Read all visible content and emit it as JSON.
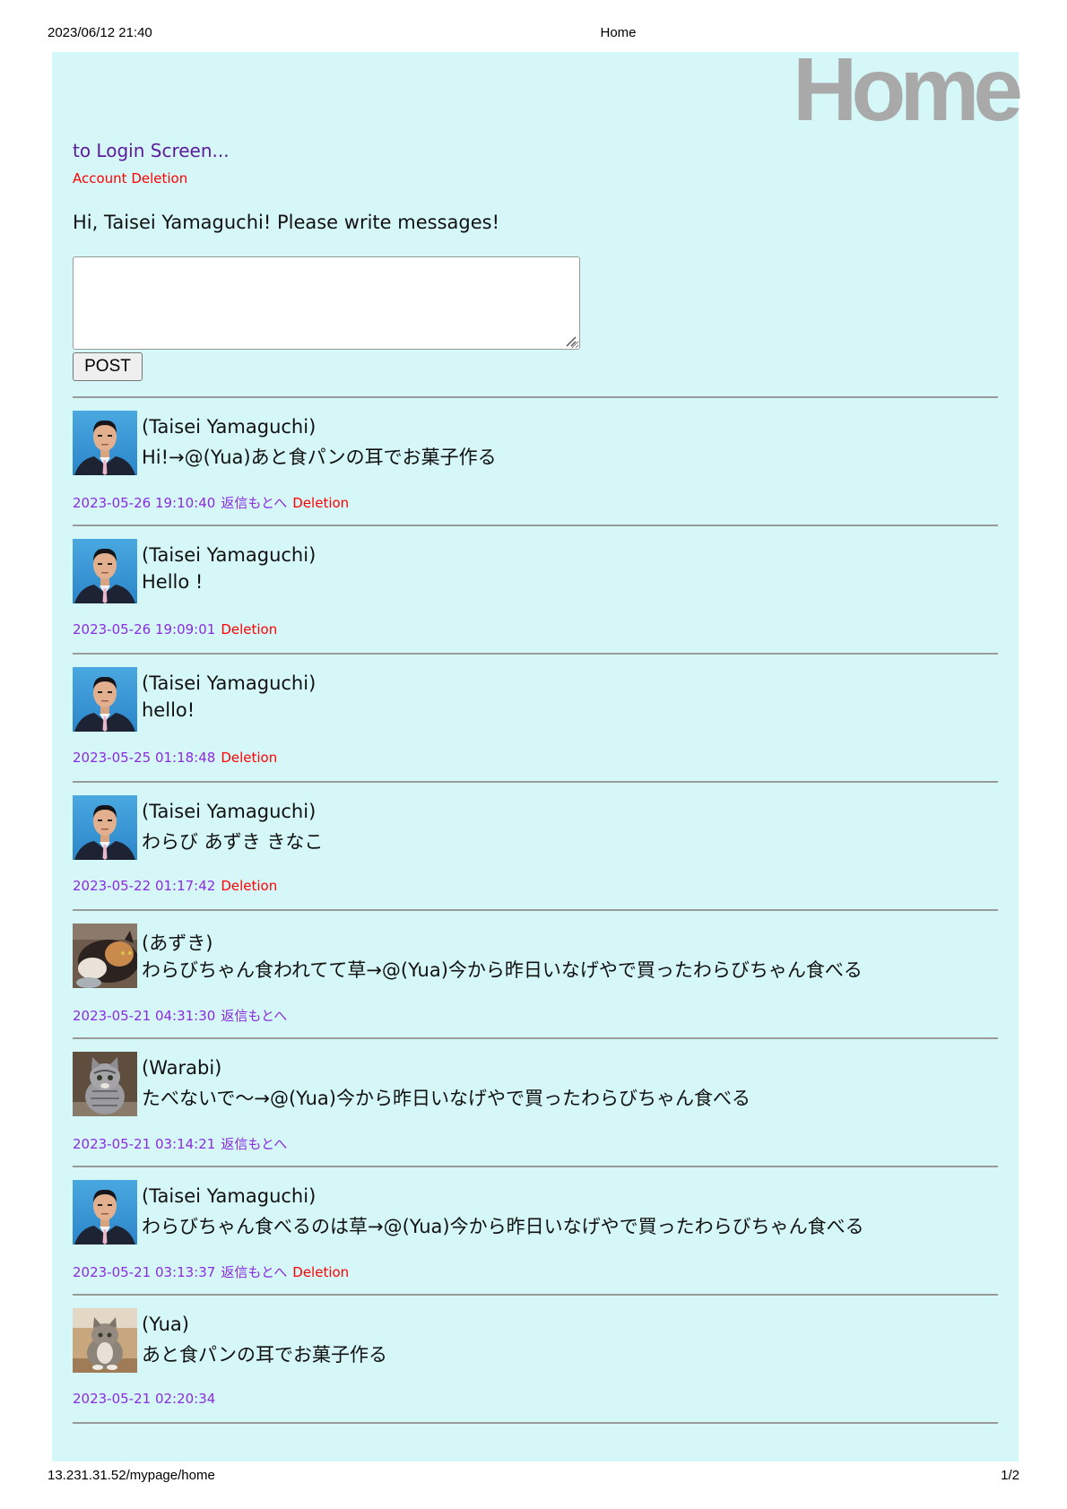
{
  "print_header": {
    "datetime": "2023/06/12 21:40",
    "title": "Home"
  },
  "print_footer": {
    "url": "13.231.31.52/mypage/home",
    "page": "1/2"
  },
  "page_title": "Home",
  "login_link": "to Login Screen...",
  "account_deletion": "Account Deletion",
  "greeting": "Hi, Taisei Yamaguchi! Please write messages!",
  "message_input": {
    "value": "",
    "placeholder": ""
  },
  "post_button": "POST",
  "posts": [
    {
      "name": "(Taisei Yamaguchi)",
      "text": "Hi!→@(Yua)あと食パンの耳でお菓子作る",
      "timestamp": "2023-05-26 19:10:40",
      "reply": "返信もとへ",
      "delete": "Deletion",
      "avatar": "person-photo"
    },
    {
      "name": "(Taisei Yamaguchi)",
      "text": "Hello !",
      "timestamp": "2023-05-26 19:09:01",
      "reply": "",
      "delete": "Deletion",
      "avatar": "person-photo"
    },
    {
      "name": "(Taisei Yamaguchi)",
      "text": "hello!",
      "timestamp": "2023-05-25 01:18:48",
      "reply": "",
      "delete": "Deletion",
      "avatar": "person-photo"
    },
    {
      "name": "(Taisei Yamaguchi)",
      "text": "わらび あずき きなこ",
      "timestamp": "2023-05-22 01:17:42",
      "reply": "",
      "delete": "Deletion",
      "avatar": "person-photo"
    },
    {
      "name": "(あずき)",
      "text": "わらびちゃん食われてて草→@(Yua)今から昨日いなげやで買ったわらびちゃん食べる",
      "timestamp": "2023-05-21 04:31:30",
      "reply": "返信もとへ",
      "delete": "",
      "avatar": "cat-calico"
    },
    {
      "name": "(Warabi)",
      "text": "たべないで～→@(Yua)今から昨日いなげやで買ったわらびちゃん食べる",
      "timestamp": "2023-05-21 03:14:21",
      "reply": "返信もとへ",
      "delete": "",
      "avatar": "cat-tabby"
    },
    {
      "name": "(Taisei Yamaguchi)",
      "text": "わらびちゃん食べるのは草→@(Yua)今から昨日いなげやで買ったわらびちゃん食べる",
      "timestamp": "2023-05-21 03:13:37",
      "reply": "返信もとへ",
      "delete": "Deletion",
      "avatar": "person-photo"
    },
    {
      "name": "(Yua)",
      "text": "あと食パンの耳でお菓子作る",
      "timestamp": "2023-05-21 02:20:34",
      "reply": "",
      "delete": "",
      "avatar": "cat-sitting"
    }
  ],
  "colors": {
    "page_bg": "#d6f7f7",
    "title": "#a9a9a9",
    "link": "#5b1a9c",
    "delete": "#ff0000",
    "timestamp": "#8a2be2"
  }
}
